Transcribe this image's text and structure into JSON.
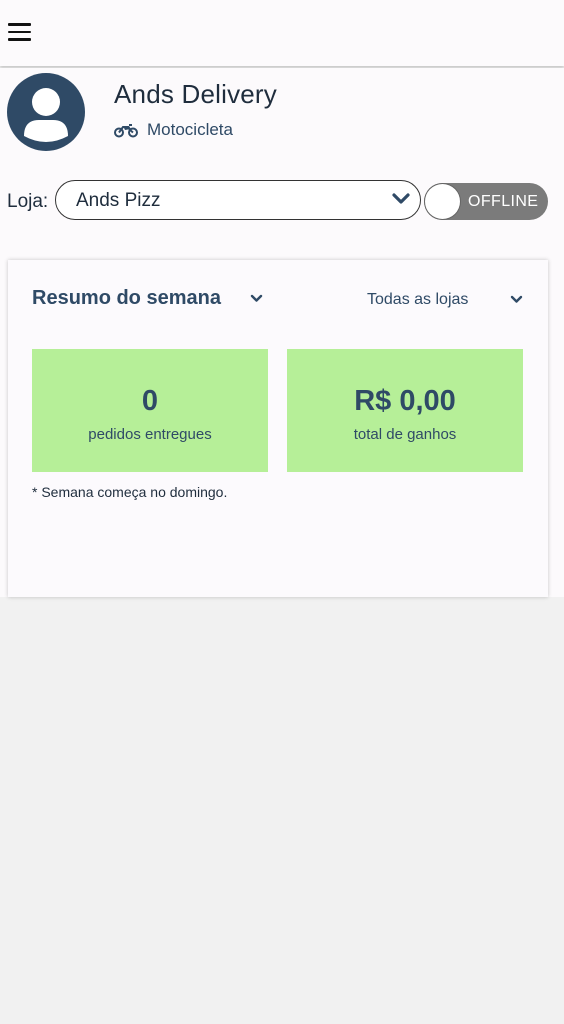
{
  "header": {
    "menu_icon": "hamburger-icon"
  },
  "driver": {
    "name": "Ands Delivery",
    "vehicle": "Motocicleta",
    "vehicle_icon": "motorcycle-icon",
    "avatar_icon": "user-avatar-icon"
  },
  "store": {
    "label": "Loja:",
    "selected": "Ands Pizz",
    "status_label": "OFFLINE"
  },
  "summary": {
    "title": "Resumo do semana",
    "filter": "Todas as lojas",
    "stats": [
      {
        "value": "0",
        "label": "pedidos entregues"
      },
      {
        "value": "R$ 0,00",
        "label": "total de ganhos"
      }
    ],
    "note": "* Semana começa no domingo."
  },
  "colors": {
    "primary": "#2f4a66",
    "stat_bg": "#b6ef98",
    "toggle_off": "#7b7b7b"
  }
}
